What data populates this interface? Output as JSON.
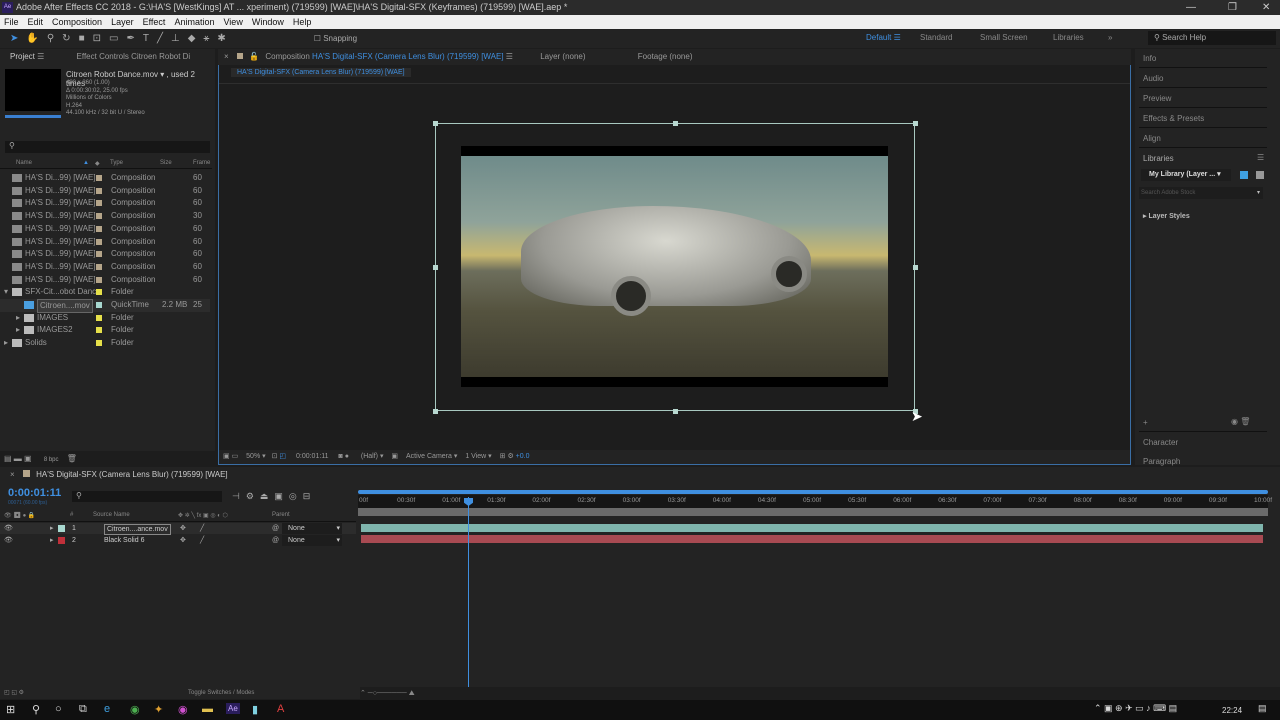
{
  "title": "Adobe After Effects CC 2018 - G:\\HA'S [WestKings] AT ... xperiment) (719599) [WAE]\\HA'S Digital-SFX (Keyframes) (719599) [WAE].aep *",
  "menu": [
    "File",
    "Edit",
    "Composition",
    "Layer",
    "Effect",
    "Animation",
    "View",
    "Window",
    "Help"
  ],
  "toolbar": {
    "snapping": "Snapping"
  },
  "workspaces": {
    "active": "Default",
    "items": [
      "Standard",
      "Small Screen",
      "Libraries"
    ]
  },
  "search_help": "Search Help",
  "project": {
    "tab": "Project",
    "effect_tab": "Effect Controls Citroen Robot Di",
    "footage_name": "Citroen Robot Dance.mov",
    "used": ", used 2 times",
    "info": [
      "480 x 360 (1.00)",
      "Δ 0:00:30:02, 25.00 fps",
      "Millions of Colors",
      "H.264",
      "44.100 kHz / 32 bit U / Stereo"
    ],
    "columns": [
      "Name",
      "Type",
      "Size",
      "Frame"
    ],
    "rows": [
      {
        "name": "HA'S Di...99) [WAE]",
        "type": "Composition",
        "size": "",
        "frame": "60",
        "color": "#b5a58a"
      },
      {
        "name": "HA'S Di...99) [WAE]",
        "type": "Composition",
        "size": "",
        "frame": "60",
        "color": "#b5a58a"
      },
      {
        "name": "HA'S Di...99) [WAE]",
        "type": "Composition",
        "size": "",
        "frame": "60",
        "color": "#b5a58a"
      },
      {
        "name": "HA'S Di...99) [WAE]",
        "type": "Composition",
        "size": "",
        "frame": "30",
        "color": "#b5a58a"
      },
      {
        "name": "HA'S Di...99) [WAE]",
        "type": "Composition",
        "size": "",
        "frame": "60",
        "color": "#b5a58a"
      },
      {
        "name": "HA'S Di...99) [WAE]",
        "type": "Composition",
        "size": "",
        "frame": "60",
        "color": "#b5a58a"
      },
      {
        "name": "HA'S Di...99) [WAE]",
        "type": "Composition",
        "size": "",
        "frame": "60",
        "color": "#b5a58a"
      },
      {
        "name": "HA'S Di...99) [WAE]",
        "type": "Composition",
        "size": "",
        "frame": "60",
        "color": "#b5a58a"
      },
      {
        "name": "HA'S Di...99) [WAE]",
        "type": "Composition",
        "size": "",
        "frame": "60",
        "color": "#b5a58a"
      },
      {
        "name": "SFX-Cit...obot Dance",
        "type": "Folder",
        "size": "",
        "frame": "",
        "color": "#e6e04a"
      },
      {
        "name": "Citroen....mov",
        "type": "QuickTime",
        "size": "2.2 MB",
        "frame": "25",
        "color": "#a8d8d0"
      },
      {
        "name": "IMAGES",
        "type": "Folder",
        "size": "",
        "frame": "",
        "color": "#e6e04a"
      },
      {
        "name": "IMAGES2",
        "type": "Folder",
        "size": "",
        "frame": "",
        "color": "#e6e04a"
      },
      {
        "name": "Solids",
        "type": "Folder",
        "size": "",
        "frame": "",
        "color": "#e6e04a"
      }
    ],
    "bpc": "8 bpc"
  },
  "comp": {
    "tab_prefix": "Composition",
    "tab_name": "HA'S Digital-SFX (Camera Lens Blur) (719599) [WAE]",
    "layer_tab": "Layer (none)",
    "footage_tab": "Footage (none)",
    "breadcrumb": "HA'S Digital-SFX (Camera Lens Blur) (719599) [WAE]",
    "zoom": "50%",
    "time": "0:00:01:11",
    "resolution": "(Half)",
    "camera": "Active Camera",
    "views": "1 View",
    "exposure": "+0.0"
  },
  "right": {
    "panels": [
      "Info",
      "Audio",
      "Preview",
      "Effects & Presets",
      "Align"
    ],
    "libraries": "Libraries",
    "library_select": "My Library (Layer ...",
    "stock_placeholder": "Search Adobe Stock",
    "layer_styles": "Layer Styles",
    "bottom": [
      "Character",
      "Paragraph"
    ]
  },
  "timeline": {
    "tab": "HA'S Digital-SFX (Camera Lens Blur) (719599) [WAE]",
    "timecode": "0:00:01:11",
    "frames": "00071 (60.00 fps)",
    "columns": {
      "source": "Source Name",
      "parent": "Parent"
    },
    "layers": [
      {
        "num": "1",
        "name": "Citroen....ance.mov",
        "parent": "None",
        "color": "#a8d8d0",
        "bar": "#7fb5ad"
      },
      {
        "num": "2",
        "name": "Black Solid 6",
        "parent": "None",
        "color": "#c0303a",
        "bar": "#a84a52"
      }
    ],
    "ticks": [
      "00f",
      "00:30f",
      "01:00f",
      "01:30f",
      "02:00f",
      "02:30f",
      "03:00f",
      "03:30f",
      "04:00f",
      "04:30f",
      "05:00f",
      "05:30f",
      "06:00f",
      "06:30f",
      "07:00f",
      "07:30f",
      "08:00f",
      "08:30f",
      "09:00f",
      "09:30f",
      "10:00f"
    ],
    "toggle": "Toggle Switches / Modes"
  },
  "taskbar": {
    "clock": "22:24"
  }
}
